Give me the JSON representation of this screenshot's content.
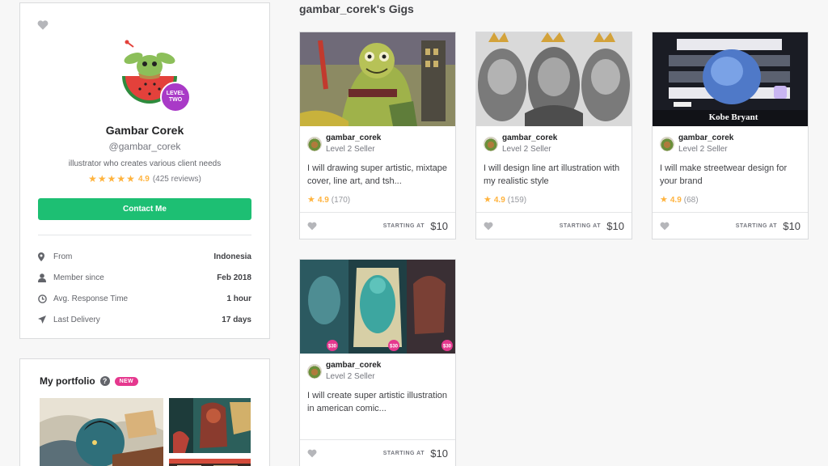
{
  "profile": {
    "name": "Gambar Corek",
    "handle": "@gambar_corek",
    "description": "illustrator who creates various client needs",
    "level_badge": [
      "LEVEL",
      "TWO"
    ],
    "rating": "4.9",
    "reviews": "(425 reviews)",
    "contact_label": "Contact Me",
    "stats": [
      {
        "icon": "location-pin-icon",
        "label": "From",
        "value": "Indonesia"
      },
      {
        "icon": "user-icon",
        "label": "Member since",
        "value": "Feb 2018"
      },
      {
        "icon": "clock-icon",
        "label": "Avg. Response Time",
        "value": "1 hour"
      },
      {
        "icon": "paper-plane-icon",
        "label": "Last Delivery",
        "value": "17 days"
      }
    ]
  },
  "portfolio": {
    "title": "My portfolio",
    "help": "?",
    "badge": "NEW"
  },
  "gigs": {
    "title": "gambar_corek's Gigs",
    "items": [
      {
        "seller": "gambar_corek",
        "level": "Level 2 Seller",
        "title": "I will drawing super artistic, mixtape cover, line art, and tsh...",
        "rating": "4.9",
        "count": "(170)",
        "price_label": "STARTING AT",
        "price": "$10"
      },
      {
        "seller": "gambar_corek",
        "level": "Level 2 Seller",
        "title": "I will design line art illustration with my realistic style",
        "rating": "4.9",
        "count": "(159)",
        "price_label": "STARTING AT",
        "price": "$10"
      },
      {
        "seller": "gambar_corek",
        "level": "Level 2 Seller",
        "title": "I will make streetwear design for your brand",
        "rating": "4.9",
        "count": "(68)",
        "price_label": "STARTING AT",
        "price": "$10"
      },
      {
        "seller": "gambar_corek",
        "level": "Level 2 Seller",
        "title": "I will create super artistic illustration in american comic...",
        "price_label": "STARTING AT",
        "price": "$10"
      }
    ],
    "thumb_texts": {
      "gig3_banner": "Kobe Bryant",
      "gig4_tags": [
        "$30",
        "$30",
        "$30"
      ]
    }
  },
  "colors": {
    "accent_green": "#1dbf73",
    "star": "#ffb33e",
    "level_badge": "#a93ac7",
    "new_badge": "#e5388e"
  }
}
